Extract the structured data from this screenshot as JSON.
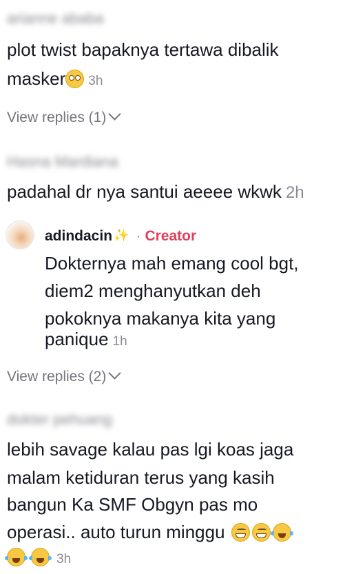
{
  "comments": [
    {
      "username": "arianne ababa",
      "lines": [
        "plot twist bapaknya tertawa dibalik",
        "masker"
      ],
      "emoji": "flushed-face",
      "time": "3h",
      "view_replies": "View replies (1)"
    },
    {
      "username": "Hasna Mardiana",
      "lines": [
        "padahal dr nya santui aeeee wkwk"
      ],
      "time": "2h"
    },
    {
      "username": "adindacin",
      "sparkle_icon": "sparkles",
      "separator": "·",
      "badge": "Creator",
      "lines": [
        "Dokternya mah emang cool bgt,",
        "diem2 menghanyutkan deh",
        "pokoknya makanya kita yang",
        "panique"
      ],
      "time": "1h",
      "view_replies": "View replies (2)"
    },
    {
      "username": "dokter pehuang",
      "lines": [
        "lebih savage kalau pas lgi koas jaga",
        "malam ketiduran terus yang kasih",
        "bangun Ka SMF Obgyn pas mo",
        "operasi.. auto turun minggu"
      ],
      "emojis": [
        "grinning-face",
        "grinning-face",
        "face-with-tears-of-joy",
        "face-with-tears-of-joy",
        "face-with-tears-of-joy"
      ],
      "time": "3h"
    }
  ],
  "colors": {
    "text": "#161823",
    "muted": "#8a8b91",
    "creator": "#e33f5a"
  }
}
